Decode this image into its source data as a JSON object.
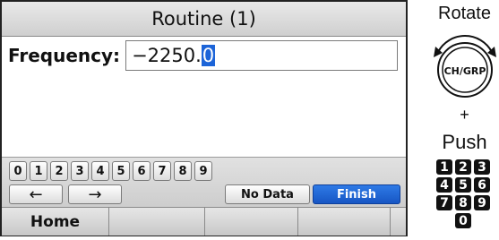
{
  "screen": {
    "title": "Routine (1)",
    "frequency_label": "Frequency:",
    "frequency_value": "−2250.",
    "frequency_cursor": "0",
    "digit_keys": [
      "0",
      "1",
      "2",
      "3",
      "4",
      "5",
      "6",
      "7",
      "8",
      "9"
    ],
    "left_arrow": "←",
    "right_arrow": "→",
    "no_data_label": "No Data",
    "finish_label": "Finish",
    "softkeys": [
      "Home",
      "",
      "",
      "",
      ""
    ]
  },
  "instructions": {
    "rotate_label": "Rotate",
    "dial_label": "CH/GRP",
    "plus": "+",
    "push_label": "Push",
    "number_keys": [
      "1",
      "2",
      "3",
      "4",
      "5",
      "6",
      "7",
      "8",
      "9",
      "0"
    ]
  },
  "colors": {
    "accent": "#1c64d8",
    "finish": "#1756c4"
  }
}
